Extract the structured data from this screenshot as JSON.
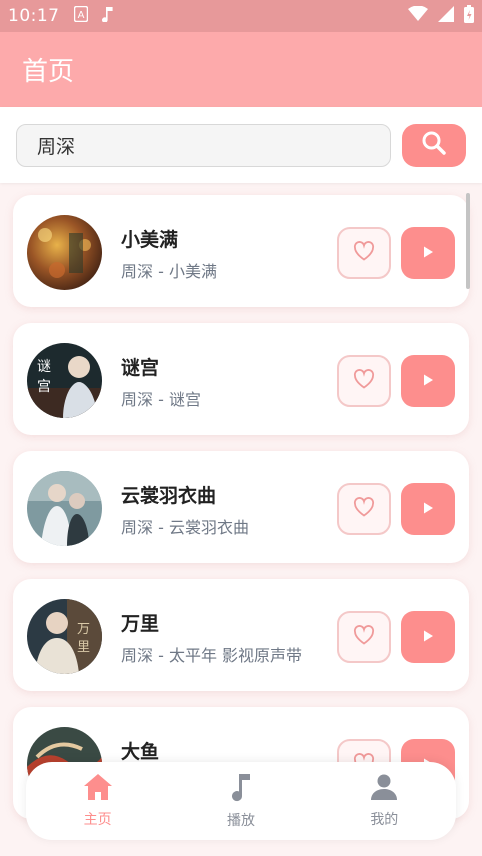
{
  "status_bar": {
    "time": "10:17"
  },
  "app_bar": {
    "title": "首页"
  },
  "search": {
    "value": "周深",
    "placeholder": "搜索"
  },
  "songs": [
    {
      "title": "小美满",
      "subtitle": "周深 - 小美满"
    },
    {
      "title": "谜宫",
      "subtitle": "周深 - 谜宫"
    },
    {
      "title": "云裳羽衣曲",
      "subtitle": "周深 - 云裳羽衣曲"
    },
    {
      "title": "万里",
      "subtitle": "周深 - 太平年 影视原声带"
    },
    {
      "title": "大鱼",
      "subtitle": ""
    }
  ],
  "bottom_nav": {
    "items": [
      {
        "label": "主页",
        "icon": "home-icon",
        "active": true
      },
      {
        "label": "播放",
        "icon": "music-note-icon",
        "active": false
      },
      {
        "label": "我的",
        "icon": "person-icon",
        "active": false
      }
    ]
  },
  "colors": {
    "accent": "#fd8e8d",
    "appbar": "#fdaaab",
    "statusbar": "#e7999a",
    "background": "#fdf3f3"
  }
}
